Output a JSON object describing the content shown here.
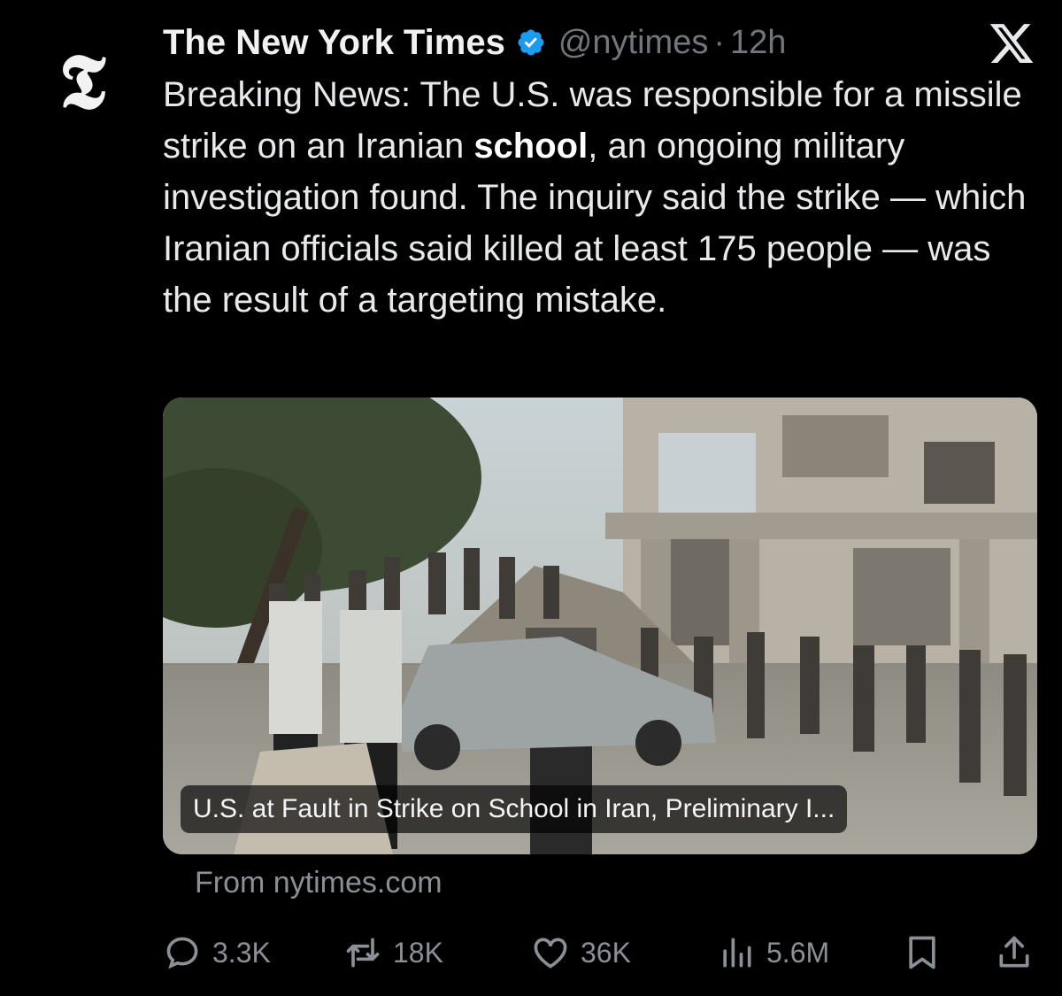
{
  "tweet": {
    "author_name": "The New York Times",
    "handle": "@nytimes",
    "separator": "·",
    "time": "12h",
    "text": {
      "part1": "Breaking News: The U.S. was responsible for a missile strike on an Iranian ",
      "bold": "school",
      "part2": ", an ongoing military investigation found. The inquiry said the strike — which Iranian officials said killed at least 175 people — was the result of a targeting mistake."
    },
    "card": {
      "caption": "U.S. at Fault in Strike on School in Iran, Preliminary I...",
      "source": "From nytimes.com"
    },
    "stats": {
      "replies": "3.3K",
      "reposts": "18K",
      "likes": "36K",
      "views": "5.6M"
    }
  },
  "avatar_glyph": "𝕿",
  "icons": {
    "avatar": "nyt-logo-icon",
    "verified": "verified-badge-icon",
    "platform": "x-logo-icon",
    "reply": "reply-icon",
    "repost": "repost-icon",
    "like": "heart-icon",
    "views": "views-icon",
    "bookmark": "bookmark-icon",
    "share": "share-icon"
  },
  "colors": {
    "background": "#000000",
    "text": "#e7e9ea",
    "muted": "#71767b",
    "verified": "#1d9bf0"
  }
}
